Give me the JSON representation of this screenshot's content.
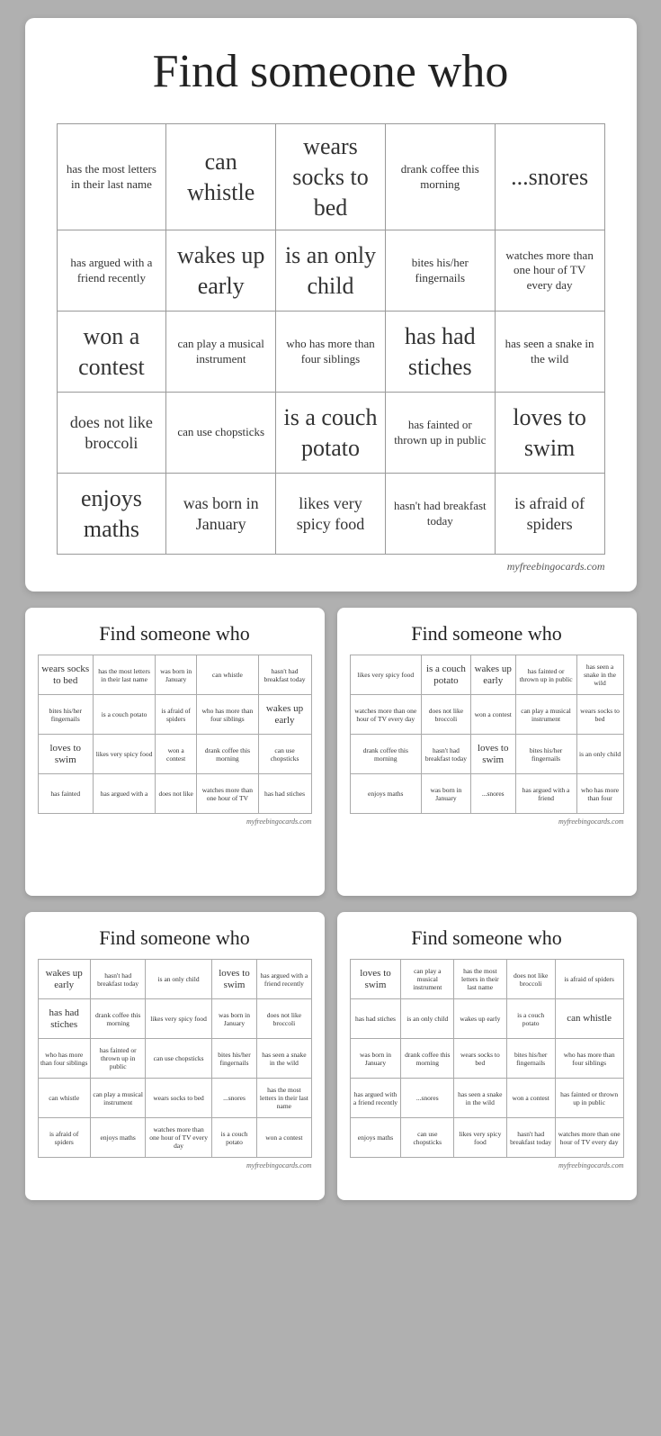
{
  "main": {
    "title": "Find someone who",
    "watermark": "myfreebingocards.com",
    "grid": [
      [
        {
          "text": "has the most letters in their last name",
          "size": "small"
        },
        {
          "text": "can whistle",
          "size": "large"
        },
        {
          "text": "wears socks to bed",
          "size": "large"
        },
        {
          "text": "drank coffee this morning",
          "size": "small"
        },
        {
          "text": "...snores",
          "size": "large"
        }
      ],
      [
        {
          "text": "has argued with a friend recently",
          "size": "small"
        },
        {
          "text": "wakes up early",
          "size": "large"
        },
        {
          "text": "is an only child",
          "size": "large"
        },
        {
          "text": "bites his/her fingernails",
          "size": "small"
        },
        {
          "text": "watches more than one hour of TV every day",
          "size": "small"
        }
      ],
      [
        {
          "text": "won a contest",
          "size": "large"
        },
        {
          "text": "can play a musical instrument",
          "size": "small"
        },
        {
          "text": "who has more than four siblings",
          "size": "small"
        },
        {
          "text": "has had stiches",
          "size": "large"
        },
        {
          "text": "has seen a snake in the wild",
          "size": "small"
        }
      ],
      [
        {
          "text": "does not like broccoli",
          "size": "medium"
        },
        {
          "text": "can use chopsticks",
          "size": "small"
        },
        {
          "text": "is a couch potato",
          "size": "large"
        },
        {
          "text": "has fainted or thrown up in public",
          "size": "small"
        },
        {
          "text": "loves to swim",
          "size": "large"
        }
      ],
      [
        {
          "text": "enjoys maths",
          "size": "large"
        },
        {
          "text": "was born in January",
          "size": "medium"
        },
        {
          "text": "likes very spicy food",
          "size": "medium"
        },
        {
          "text": "hasn't had breakfast today",
          "size": "small"
        },
        {
          "text": "is afraid of spiders",
          "size": "medium"
        }
      ]
    ]
  },
  "mini_cards": [
    {
      "title": "Find someone who",
      "watermark": "myfreebingocards.com",
      "grid": [
        [
          {
            "text": "wears socks to bed",
            "size": "lg"
          },
          {
            "text": "has the most letters in their last name"
          },
          {
            "text": "was born in January"
          },
          {
            "text": "can whistle"
          },
          {
            "text": "hasn't had breakfast today"
          }
        ],
        [
          {
            "text": "bites his/her fingernails"
          },
          {
            "text": "is a couch potato"
          },
          {
            "text": "is afraid of spiders"
          },
          {
            "text": "who has more than four siblings"
          },
          {
            "text": "wakes up early",
            "size": "lg"
          }
        ],
        [
          {
            "text": "loves to swim",
            "size": "lg"
          },
          {
            "text": "likes very spicy food"
          },
          {
            "text": "won a contest"
          },
          {
            "text": "drank coffee this morning"
          },
          {
            "text": "can use chopsticks"
          }
        ],
        [
          {
            "text": "has fainted"
          },
          {
            "text": "has argued with a"
          },
          {
            "text": "does not like"
          },
          {
            "text": "watches more than one hour of TV"
          },
          {
            "text": "has had stiches"
          }
        ]
      ]
    },
    {
      "title": "Find someone who",
      "watermark": "myfreebingocards.com",
      "grid": [
        [
          {
            "text": "likes very spicy food"
          },
          {
            "text": "is a couch potato",
            "size": "lg"
          },
          {
            "text": "wakes up early",
            "size": "lg"
          },
          {
            "text": "has fainted or thrown up in public"
          },
          {
            "text": "has seen a snake in the wild"
          }
        ],
        [
          {
            "text": "watches more than one hour of TV every day"
          },
          {
            "text": "does not like broccoli"
          },
          {
            "text": "won a contest"
          },
          {
            "text": "can play a musical instrument"
          },
          {
            "text": "wears socks to bed"
          }
        ],
        [
          {
            "text": "drank coffee this morning"
          },
          {
            "text": "hasn't had breakfast today"
          },
          {
            "text": "loves to swim",
            "size": "lg"
          },
          {
            "text": "bites his/her fingernails"
          },
          {
            "text": "is an only child"
          }
        ],
        [
          {
            "text": "enjoys maths"
          },
          {
            "text": "was born in January"
          },
          {
            "text": "...snores"
          },
          {
            "text": "has argued with a friend"
          },
          {
            "text": "who has more than four"
          }
        ]
      ]
    },
    {
      "title": "Find someone who",
      "watermark": "myfreebingocards.com",
      "grid": [
        [
          {
            "text": "wakes up early",
            "size": "lg"
          },
          {
            "text": "hasn't had breakfast today"
          },
          {
            "text": "is an only child"
          },
          {
            "text": "loves to swim",
            "size": "lg"
          },
          {
            "text": "has argued with a friend recently"
          }
        ],
        [
          {
            "text": "has had stiches",
            "size": "lg"
          },
          {
            "text": "drank coffee this morning"
          },
          {
            "text": "likes very spicy food"
          },
          {
            "text": "was born in January"
          },
          {
            "text": "does not like broccoli"
          }
        ],
        [
          {
            "text": "who has more than four siblings"
          },
          {
            "text": "has fainted or thrown up in public"
          },
          {
            "text": "can use chopsticks"
          },
          {
            "text": "bites his/her fingernails"
          },
          {
            "text": "has seen a snake in the wild"
          }
        ],
        [
          {
            "text": "can whistle"
          },
          {
            "text": "can play a musical instrument"
          },
          {
            "text": "wears socks to bed"
          },
          {
            "text": "...snores"
          },
          {
            "text": "has the most letters in their last name"
          }
        ],
        [
          {
            "text": "is afraid of spiders"
          },
          {
            "text": "enjoys maths"
          },
          {
            "text": "watches more than one hour of TV every day"
          },
          {
            "text": "is a couch potato"
          },
          {
            "text": "won a contest"
          }
        ]
      ]
    },
    {
      "title": "Find someone who",
      "watermark": "myfreebingocards.com",
      "grid": [
        [
          {
            "text": "loves to swim",
            "size": "lg"
          },
          {
            "text": "can play a musical instrument"
          },
          {
            "text": "has the most letters in their last name"
          },
          {
            "text": "does not like broccoli"
          },
          {
            "text": "is afraid of spiders"
          }
        ],
        [
          {
            "text": "has had stiches"
          },
          {
            "text": "is an only child"
          },
          {
            "text": "wakes up early"
          },
          {
            "text": "is a couch potato"
          },
          {
            "text": "can whistle",
            "size": "lg"
          }
        ],
        [
          {
            "text": "was born in January"
          },
          {
            "text": "drank coffee this morning"
          },
          {
            "text": "wears socks to bed"
          },
          {
            "text": "bites his/her fingernails"
          },
          {
            "text": "who has more than four siblings"
          }
        ],
        [
          {
            "text": "has argued with a friend recently"
          },
          {
            "text": "...snores"
          },
          {
            "text": "has seen a snake in the wild"
          },
          {
            "text": "won a contest"
          },
          {
            "text": "has fainted or thrown up in public"
          }
        ],
        [
          {
            "text": "enjoys maths"
          },
          {
            "text": "can use chopsticks"
          },
          {
            "text": "likes very spicy food"
          },
          {
            "text": "hasn't had breakfast today"
          },
          {
            "text": "watches more than one hour of TV every day"
          }
        ]
      ]
    }
  ]
}
